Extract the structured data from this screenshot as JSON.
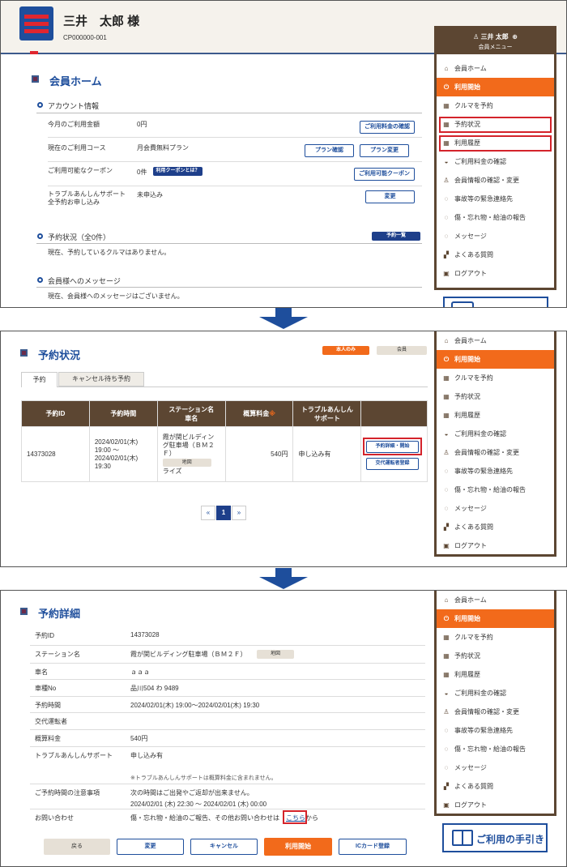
{
  "header": {
    "user_name": "三井　太郎 様",
    "member_id": "CP000000-001"
  },
  "menu_user": {
    "name": "三井 太郎",
    "sub": "会員メニュー"
  },
  "menu_items": [
    {
      "label": "会員ホーム",
      "icon": "home-icon"
    },
    {
      "label": "利用開始",
      "icon": "power-icon"
    },
    {
      "label": "クルマを予約",
      "icon": "calendar-icon"
    },
    {
      "label": "予約状況",
      "icon": "calendar-icon"
    },
    {
      "label": "利用履歴",
      "icon": "calendar-icon"
    },
    {
      "label": "ご利用料金の確認",
      "icon": "coins-icon"
    },
    {
      "label": "会員情報の確認・変更",
      "icon": "person-icon"
    },
    {
      "label": "事故等の緊急連絡先",
      "icon": "chat-icon"
    },
    {
      "label": "傷・忘れ物・給油の報告",
      "icon": "chat-icon"
    },
    {
      "label": "メッセージ",
      "icon": "chat-icon"
    },
    {
      "label": "よくある質問",
      "icon": "faq-icon"
    },
    {
      "label": "ログアウト",
      "icon": "logout-icon"
    }
  ],
  "home": {
    "title": "会員ホーム",
    "account_heading": "アカウント情報",
    "rows": [
      {
        "label": "今月のご利用金額",
        "value": "0円"
      },
      {
        "label": "現在のご利用コース",
        "value": "月会費無料プラン"
      },
      {
        "label": "ご利用可能なクーポン",
        "value": "0件"
      },
      {
        "label": "トラブルあんしんサポート",
        "label2": "全予約お申し込み",
        "value": "未申込み"
      }
    ],
    "buttons": {
      "fee_check": "ご利用料金の確認",
      "plan_check": "プラン確認",
      "plan_change": "プラン変更",
      "coupon_what": "利用クーポンとは？",
      "coupon_available": "ご利用可能クーポン",
      "change": "変更",
      "reservation_list": "予約一覧"
    },
    "reservation_heading": "予約状況（全0件）",
    "reservation_text": "現在、予約しているクルマはありません。",
    "message_heading": "会員様へのメッセージ",
    "message_text": "現在、会員様へのメッセージはございません。"
  },
  "status": {
    "title": "予約状況",
    "tag_self": "本人のみ",
    "tag_member": "会員",
    "tabs": [
      "予約",
      "キャンセル待ち予約"
    ],
    "columns": [
      "予約ID",
      "予約時間",
      "ステーション名",
      "車名",
      "概算料金",
      "トラブルあんしん",
      "サポート"
    ],
    "row": {
      "id": "14373028",
      "time1": "2024/02/01(木)",
      "time2": "19:00 ～",
      "time3": "2024/02/01(木)",
      "time4": "19:30",
      "station1": "霞が関ビルディン",
      "station2": "グ駐車場（ＢＭ２",
      "station3": "Ｆ）",
      "map": "地図",
      "car": "ライズ",
      "fee": "540円",
      "support": "申し込み有",
      "detail_btn": "予約詳細・開始",
      "driver_btn": "交代運転者登録"
    },
    "pages": [
      "«",
      "1",
      "»"
    ]
  },
  "detail": {
    "title": "予約詳細",
    "rows": [
      {
        "label": "予約ID",
        "value": "14373028"
      },
      {
        "label": "ステーション名",
        "value": "霞が関ビルディング駐車場（ＢＭ２Ｆ）"
      },
      {
        "label": "車名",
        "value": "ａａａ"
      },
      {
        "label": "車種No",
        "value": "品川504 わ 9489"
      },
      {
        "label": "予約時間",
        "value": "2024/02/01(木) 19:00～2024/02/01(木) 19:30"
      },
      {
        "label": "交代運転者",
        "value": ""
      },
      {
        "label": "概算料金",
        "value": "540円"
      },
      {
        "label": "トラブルあんしんサポート",
        "value": "申し込み有"
      },
      {
        "label": "ご予約時間の注意事項",
        "value": "次の時間はご出発やご返却が出来ません。"
      },
      {
        "label": "お問い合わせ",
        "value": "傷・忘れ物・給油のご報告、その他お問い合わせは"
      }
    ],
    "support_note": "※トラブルあんしんサポートは概算料金に含まれません。",
    "caution_time": "2024/02/01 (木) 22:30 ～ 2024/02/01 (木) 00:00",
    "map": "地図",
    "link": "こちら",
    "link_suffix": "から",
    "buttons": {
      "back": "戻る",
      "change": "変更",
      "cancel": "キャンセル",
      "start": "利用開始",
      "ic": "ICカード登録"
    },
    "guide": "ご利用の手引き"
  }
}
